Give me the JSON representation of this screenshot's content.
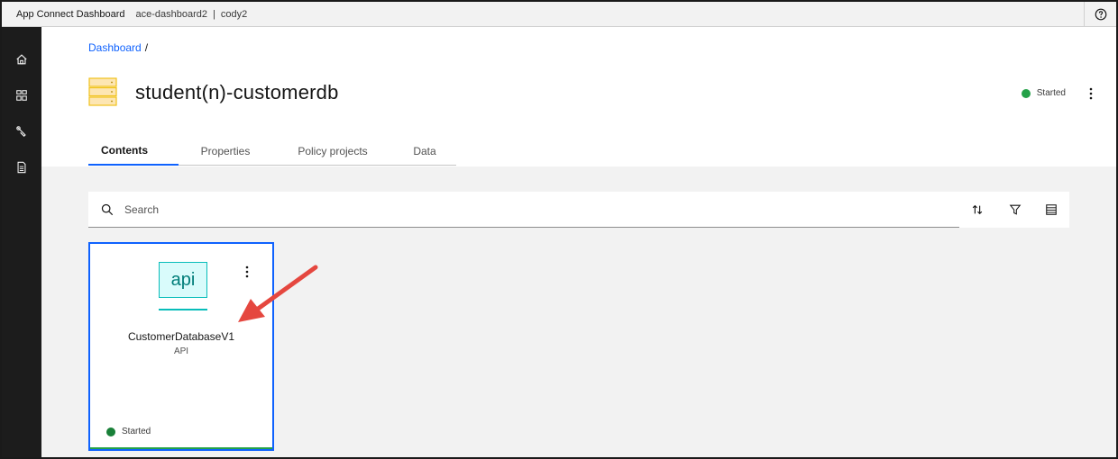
{
  "topbar": {
    "app_title": "App Connect Dashboard",
    "context": "ace-dashboard2",
    "separator": "|",
    "user": "cody2",
    "help_icon": "help-icon"
  },
  "rail": {
    "items": [
      {
        "icon": "home-icon"
      },
      {
        "icon": "dashboard-icon"
      },
      {
        "icon": "tools-icon"
      },
      {
        "icon": "document-icon"
      }
    ]
  },
  "breadcrumb": {
    "link": "Dashboard",
    "separator": "/"
  },
  "server": {
    "icon": "server-icon",
    "title": "student(n)-customerdb",
    "status": "Started",
    "status_color": "#24a148"
  },
  "tabs": [
    {
      "label": "Contents",
      "active": true
    },
    {
      "label": "Properties",
      "active": false
    },
    {
      "label": "Policy projects",
      "active": false
    },
    {
      "label": "Data",
      "active": false
    }
  ],
  "search": {
    "placeholder": "Search",
    "value": ""
  },
  "toolbar": {
    "sort_icon": "sort-icon",
    "filter_icon": "filter-icon",
    "view_icon": "list-view-icon"
  },
  "card": {
    "logo_text": "api",
    "name": "CustomerDatabaseV1",
    "type": "API",
    "status": "Started",
    "status_color": "#198038",
    "selected_border": "#0f62fe"
  },
  "annotation": {
    "arrow_color": "#e5473f"
  }
}
